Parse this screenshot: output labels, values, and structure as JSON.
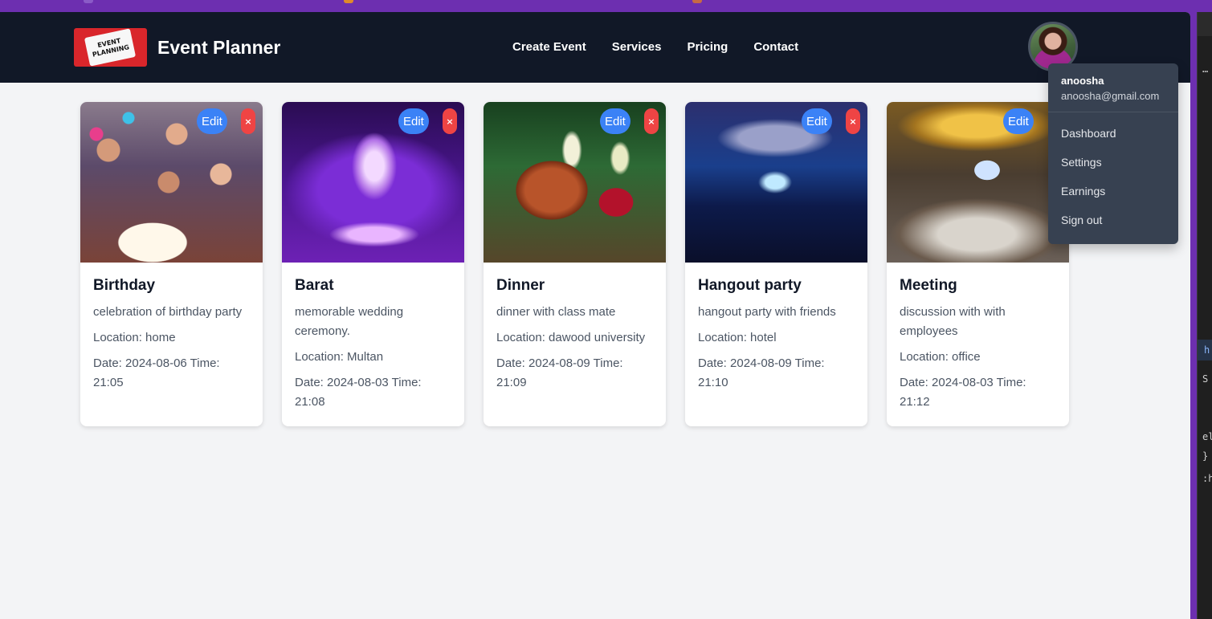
{
  "brand": {
    "name": "Event Planner",
    "logo_text": [
      "EVENT",
      "PLANNING"
    ]
  },
  "nav": {
    "items": [
      "Create Event",
      "Services",
      "Pricing",
      "Contact"
    ]
  },
  "user": {
    "name": "anoosha",
    "email": "anoosha@gmail.com",
    "menu": [
      "Dashboard",
      "Settings",
      "Earnings",
      "Sign out"
    ]
  },
  "card_buttons": {
    "edit": "Edit",
    "delete": "×"
  },
  "events": [
    {
      "title": "Birthday",
      "description": "celebration of birthday party",
      "location": "Location: home",
      "date": "Date: 2024-08-06 Time: 21:05"
    },
    {
      "title": "Barat",
      "description": "memorable wedding ceremony.",
      "location": "Location: Multan",
      "date": "Date: 2024-08-03 Time: 21:08"
    },
    {
      "title": "Dinner",
      "description": "dinner with class mate",
      "location": "Location: dawood university",
      "date": "Date: 2024-08-09 Time: 21:09"
    },
    {
      "title": "Hangout party",
      "description": "hangout party with friends",
      "location": "Location: hotel",
      "date": "Date: 2024-08-09 Time: 21:10"
    },
    {
      "title": "Meeting",
      "description": "discussion with with employees",
      "location": "Location: office",
      "date": "Date: 2024-08-03 Time: 21:12"
    }
  ],
  "colors": {
    "navbar": "#111827",
    "page_bg": "#f3f4f6",
    "edit_button": "#3b82f6",
    "delete_button": "#ef4444",
    "dropdown_bg": "#374151",
    "browser_frame": "#6d2fb0"
  },
  "devtools": {
    "fragments": [
      "…",
      "h",
      "S",
      "el",
      "}",
      ":h"
    ]
  }
}
